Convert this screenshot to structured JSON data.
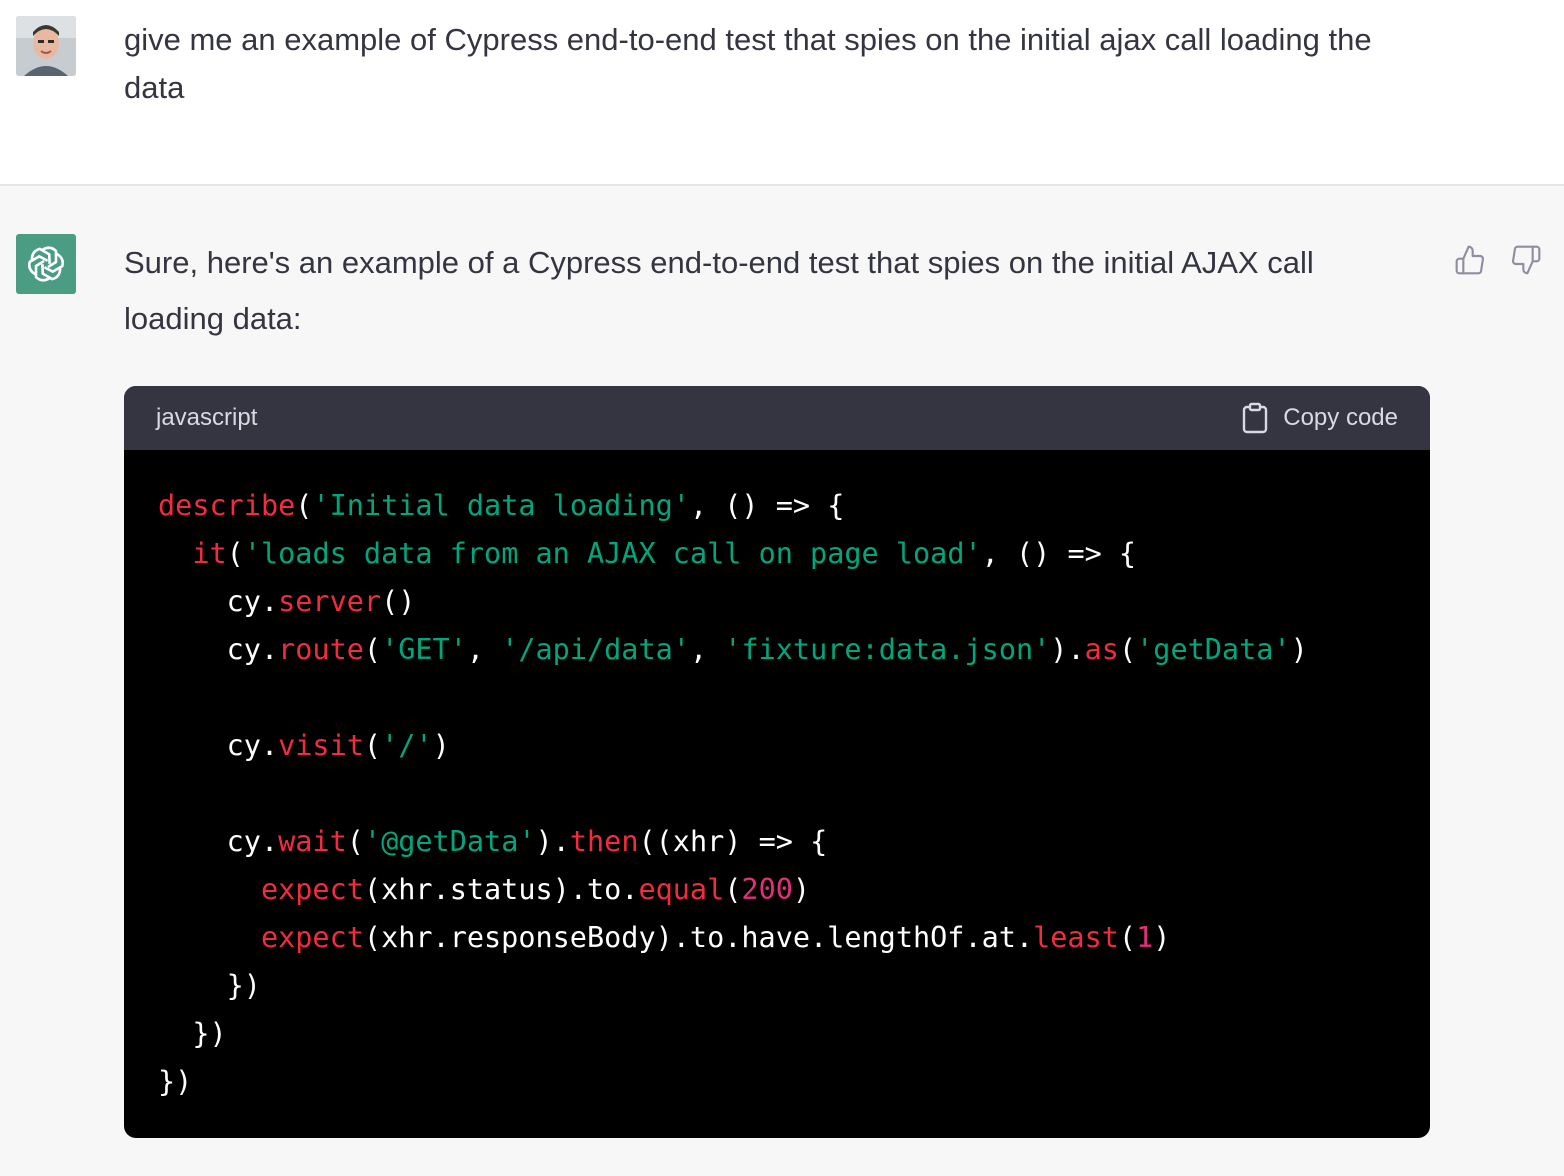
{
  "user_message": {
    "text": "give me an example of Cypress end-to-end test that spies on the initial ajax call loading the data"
  },
  "assistant_message": {
    "intro": "Sure, here's an example of a Cypress end-to-end test that spies on the initial AJAX call loading data:",
    "code_block": {
      "language": "javascript",
      "copy_label": "Copy code",
      "lines": [
        [
          {
            "t": "describe",
            "c": "kw"
          },
          {
            "t": "(",
            "c": "pl"
          },
          {
            "t": "'Initial data loading'",
            "c": "str"
          },
          {
            "t": ", () => {",
            "c": "pl"
          }
        ],
        [
          {
            "t": "  ",
            "c": "pl"
          },
          {
            "t": "it",
            "c": "kw"
          },
          {
            "t": "(",
            "c": "pl"
          },
          {
            "t": "'loads data from an AJAX call on page load'",
            "c": "str"
          },
          {
            "t": ", () => {",
            "c": "pl"
          }
        ],
        [
          {
            "t": "    cy.",
            "c": "pl"
          },
          {
            "t": "server",
            "c": "kw"
          },
          {
            "t": "()",
            "c": "pl"
          }
        ],
        [
          {
            "t": "    cy.",
            "c": "pl"
          },
          {
            "t": "route",
            "c": "kw"
          },
          {
            "t": "(",
            "c": "pl"
          },
          {
            "t": "'GET'",
            "c": "str"
          },
          {
            "t": ", ",
            "c": "pl"
          },
          {
            "t": "'/api/data'",
            "c": "str"
          },
          {
            "t": ", ",
            "c": "pl"
          },
          {
            "t": "'fixture:data.json'",
            "c": "str"
          },
          {
            "t": ").",
            "c": "pl"
          },
          {
            "t": "as",
            "c": "kw"
          },
          {
            "t": "(",
            "c": "pl"
          },
          {
            "t": "'getData'",
            "c": "str"
          },
          {
            "t": ")",
            "c": "pl"
          }
        ],
        [
          {
            "t": "",
            "c": "pl"
          }
        ],
        [
          {
            "t": "    cy.",
            "c": "pl"
          },
          {
            "t": "visit",
            "c": "kw"
          },
          {
            "t": "(",
            "c": "pl"
          },
          {
            "t": "'/'",
            "c": "str"
          },
          {
            "t": ")",
            "c": "pl"
          }
        ],
        [
          {
            "t": "",
            "c": "pl"
          }
        ],
        [
          {
            "t": "    cy.",
            "c": "pl"
          },
          {
            "t": "wait",
            "c": "kw"
          },
          {
            "t": "(",
            "c": "pl"
          },
          {
            "t": "'@getData'",
            "c": "str"
          },
          {
            "t": ").",
            "c": "pl"
          },
          {
            "t": "then",
            "c": "kw"
          },
          {
            "t": "((xhr) => {",
            "c": "pl"
          }
        ],
        [
          {
            "t": "      ",
            "c": "pl"
          },
          {
            "t": "expect",
            "c": "kw"
          },
          {
            "t": "(xhr.status).to.",
            "c": "pl"
          },
          {
            "t": "equal",
            "c": "kw"
          },
          {
            "t": "(",
            "c": "pl"
          },
          {
            "t": "200",
            "c": "num"
          },
          {
            "t": ")",
            "c": "pl"
          }
        ],
        [
          {
            "t": "      ",
            "c": "pl"
          },
          {
            "t": "expect",
            "c": "kw"
          },
          {
            "t": "(xhr.responseBody).to.have.lengthOf.at.",
            "c": "pl"
          },
          {
            "t": "least",
            "c": "kw"
          },
          {
            "t": "(",
            "c": "pl"
          },
          {
            "t": "1",
            "c": "num"
          },
          {
            "t": ")",
            "c": "pl"
          }
        ],
        [
          {
            "t": "    })",
            "c": "pl"
          }
        ],
        [
          {
            "t": "  })",
            "c": "pl"
          }
        ],
        [
          {
            "t": "})",
            "c": "pl"
          }
        ]
      ]
    },
    "feedback": {
      "thumbs_up_icon": "thumbs-up-icon",
      "thumbs_down_icon": "thumbs-down-icon"
    }
  },
  "colors": {
    "ai_background": "#f7f7f8",
    "ai_logo": "#4a9d83",
    "code_header": "#343541",
    "code_body": "#000000",
    "keyword": "#f22c3d",
    "string": "#00a67d",
    "number": "#df3079"
  }
}
